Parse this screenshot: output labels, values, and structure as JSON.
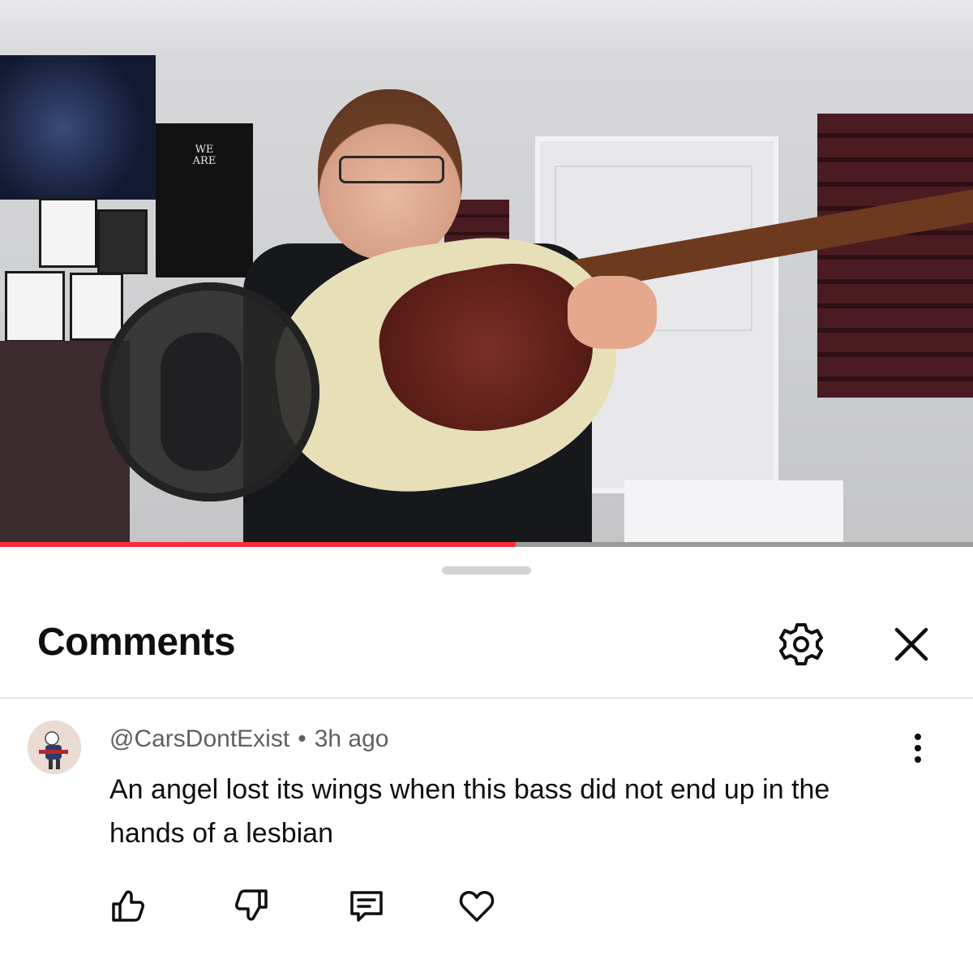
{
  "video": {
    "progress": 0.53,
    "accent_color": "#ff2b3a"
  },
  "sheet": {
    "title": "Comments",
    "icons": {
      "settings": "gear-icon",
      "close": "close-icon"
    }
  },
  "comment": {
    "author": "@CarsDontExist",
    "separator": "•",
    "timestamp": "3h ago",
    "text": "An angel lost its wings when this bass did not end up in the hands of a lesbian",
    "actions": [
      "thumbs-up-icon",
      "thumbs-down-icon",
      "reply-icon",
      "heart-icon"
    ]
  }
}
